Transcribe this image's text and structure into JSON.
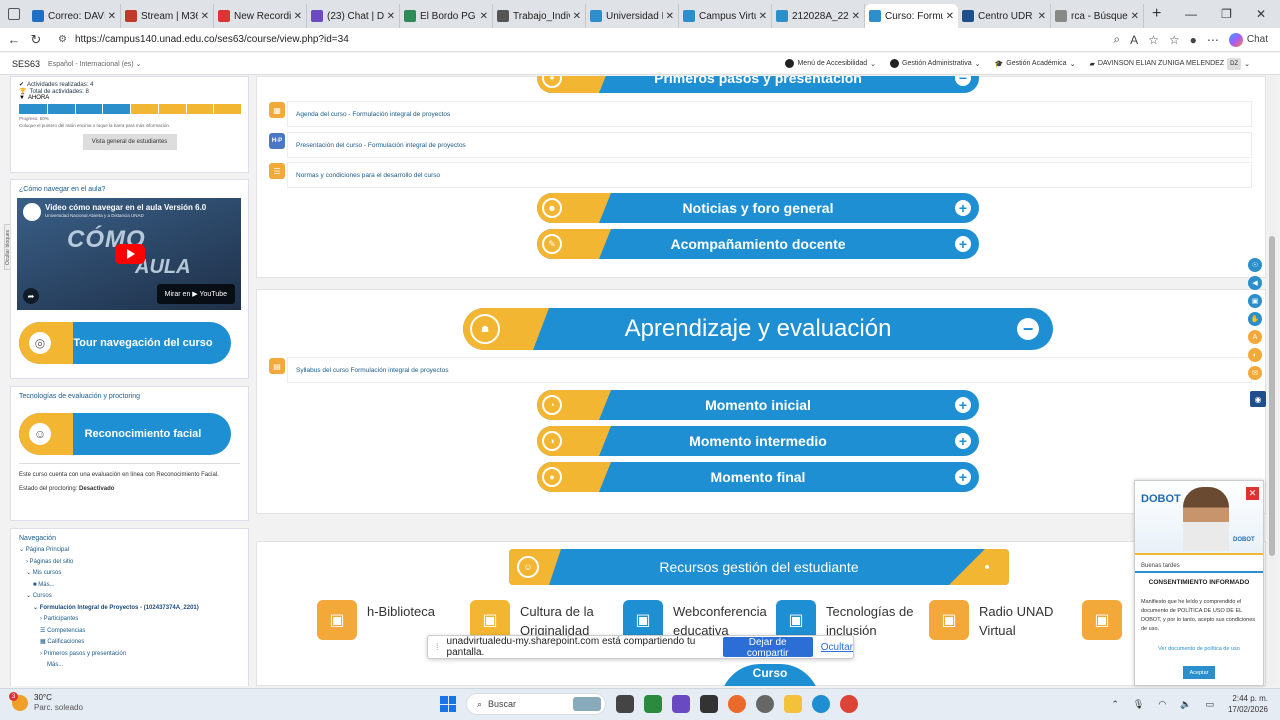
{
  "browser": {
    "tabs": [
      {
        "label": "Correo: DAVINS",
        "color": "#1f6fc5"
      },
      {
        "label": "Stream | M365",
        "color": "#c0392b"
      },
      {
        "label": "New Recording",
        "color": "#d33"
      },
      {
        "label": "(23) Chat | DAVI",
        "color": "#6b4ac2"
      },
      {
        "label": "El Bordo PG 16",
        "color": "#2e8b57"
      },
      {
        "label": "Trabajo_Individ",
        "color": "#555"
      },
      {
        "label": "Universidad Na",
        "color": "#2b8fcc"
      },
      {
        "label": "Campus Virtual",
        "color": "#2b8fcc"
      },
      {
        "label": "212028A_2201",
        "color": "#2b8fcc"
      },
      {
        "label": "Curso: Formula",
        "color": "#2b8fcc"
      },
      {
        "label": "Centro UDR El",
        "color": "#1f4f8a"
      },
      {
        "label": "rca - Búsqueda",
        "color": "#888"
      }
    ],
    "active_tab_index": 9,
    "url": "https://campus140.unad.edu.co/ses63/course/view.php?id=34",
    "chat_label": "Chat"
  },
  "moodle_bar": {
    "site_short": "SES63",
    "language": "Español - Internacional (es)",
    "accessibility_menu": "Menú de Accesibilidad",
    "admin_menu": "Gestión Administrativa",
    "academic_menu": "Gestión Académica",
    "user_name": "DAVINSON ELIAN ZUNIGA MELENDEZ",
    "user_initials": "DZ"
  },
  "sidebar": {
    "blocks_label": "Ocultar bloques",
    "progress_block": {
      "activities_done": "Actividades realizadas: 4",
      "total_activities": "Total de actividades: 8",
      "now_label": "AHORA",
      "progress_fraction": 0.5,
      "progress_text": "Progreso: 50%",
      "hint": "Coloque el puntero del ratón encima o toque la barra para más información.",
      "overview_button": "Vista general de estudiantes"
    },
    "nav_help": {
      "title": "¿Cómo navegar en el aula?",
      "video_title": "Video cómo navegar en el aula Versión 6.0",
      "video_subtitle": "Universidad Nacional Abierta y a Distancia UNAD",
      "video_overlay_1": "CÓMO",
      "video_overlay_2": "AULA",
      "watch_on": "Mirar en ▶ YouTube",
      "tour_button": "Tour navegación del curso"
    },
    "proctoring": {
      "title": "Tecnologías de evaluación y proctoring",
      "button": "Reconocimiento facial",
      "info": "Este curso cuenta con una evaluación en línea con Reconocimiento Facial.",
      "status_label": "Estado del proctoring:",
      "status_value": "Desactivado"
    },
    "navigation": {
      "title": "Navegación",
      "items": [
        {
          "label": "Página Principal",
          "indent": 0,
          "prefix": "⌄"
        },
        {
          "label": "Páginas del sitio",
          "indent": 1,
          "prefix": "›"
        },
        {
          "label": "Mis cursos",
          "indent": 1,
          "prefix": "⌄"
        },
        {
          "label": "Más...",
          "indent": 2,
          "prefix": "■"
        },
        {
          "label": "Cursos",
          "indent": 1,
          "prefix": "⌄"
        },
        {
          "label": "Formulación Integral de Proyectos - (102437374A_2201)",
          "indent": 2,
          "prefix": "⌄",
          "bold": true
        },
        {
          "label": "Participantes",
          "indent": 3,
          "prefix": "›"
        },
        {
          "label": "Competencias",
          "indent": 3,
          "prefix": "☰"
        },
        {
          "label": "Calificaciones",
          "indent": 3,
          "prefix": "▦"
        },
        {
          "label": "Primeros pasos y presentación",
          "indent": 3,
          "prefix": "›"
        },
        {
          "label": "Más...",
          "indent": 4,
          "prefix": ""
        }
      ]
    }
  },
  "main": {
    "section1": {
      "header": "Primeros pasos y presentación",
      "activities": [
        "Agenda del curso - Formulación integral de proyectos",
        "Presentación del curso - Formulación integral de proyectos",
        "Normas y condiciones para el desarrollo del curso"
      ],
      "presentation_icon_label": "H-P",
      "subsections": [
        "Noticias y foro general",
        "Acompañamiento docente"
      ]
    },
    "section2": {
      "header": "Aprendizaje y evaluación",
      "activity": "Syllabus del curso Formulación integral de proyectos",
      "subsections": [
        "Momento inicial",
        "Momento intermedio",
        "Momento final"
      ]
    },
    "section3": {
      "header": "Recursos gestión del estudiante",
      "resources": [
        {
          "label": "h-Biblioteca",
          "color": "#f3a93a"
        },
        {
          "label": "Cultura de la Originalidad",
          "color": "#f3b632"
        },
        {
          "label": "Webconferencia educativa",
          "color": "#1f8fd3"
        },
        {
          "label": "Tecnologías de inclusión",
          "color": "#1f8fd3"
        },
        {
          "label": "Radio UNAD Virtual",
          "color": "#f3a93a"
        },
        {
          "label": "",
          "color": "#f3a93a"
        }
      ],
      "curso_tab": "Curso"
    }
  },
  "dobot": {
    "logo": "DOBOT",
    "greeting": "Buenas tardes",
    "consent_title": "CONSENTIMIENTO INFORMADO",
    "consent_text": "Manifiesto que he leído y comprendido el documento de POLÍTICA DE USO DE EL DOBOT, y por lo tanto, acepto sus condiciones de uso.",
    "policy_link": "Ver documento de política de uso",
    "accept_button": "Aceptar"
  },
  "share_bar": {
    "message": "unadvirtualedu-my.sharepoint.com está compartiendo tu pantalla.",
    "stop_button": "Dejar de compartir",
    "hide_link": "Ocultar"
  },
  "taskbar": {
    "weather_temp": "30°C",
    "weather_desc": "Parc. soleado",
    "weather_badge": "3",
    "search_placeholder": "Buscar",
    "time": "2:44 p. m.",
    "date": "17/02/2026"
  },
  "colors": {
    "unad_blue": "#1f8fd3",
    "unad_yellow": "#f3b632"
  }
}
